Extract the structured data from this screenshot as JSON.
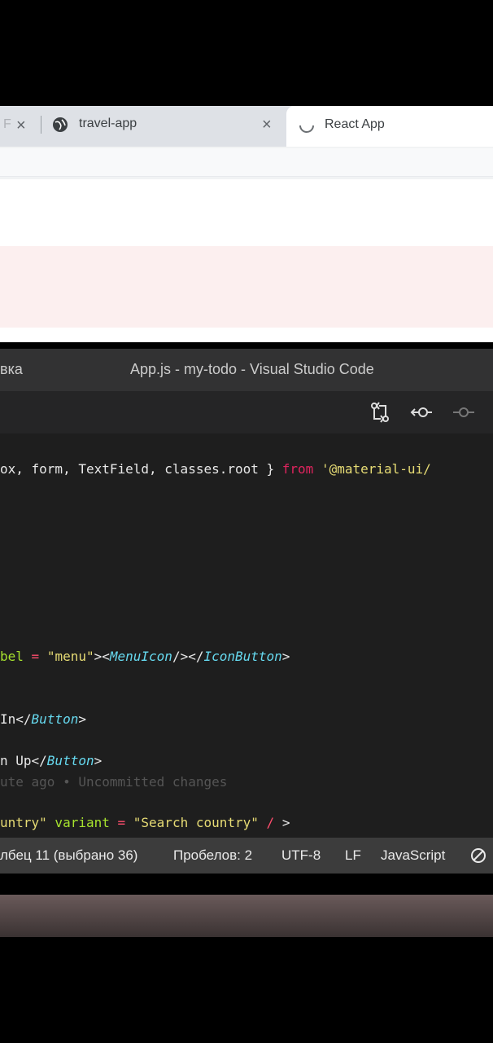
{
  "browser": {
    "tabs": [
      {
        "label": "F",
        "active": false
      },
      {
        "label": "travel-app",
        "active": false
      },
      {
        "label": "React App",
        "active": true
      }
    ]
  },
  "vscode": {
    "menu_partial": "вка",
    "title": "App.js - my-todo - Visual Studio Code",
    "code_lines": {
      "import_prefix": "ox, form, TextField, classes.root } ",
      "import_from": "from",
      "import_path": " '@material-ui/",
      "icon_line_a": "bel",
      "icon_line_b": " = ",
      "icon_line_c": "\"menu\"",
      "icon_line_d": "><",
      "icon_line_e": "MenuIcon",
      "icon_line_f": "/></",
      "icon_line_g": "IconButton",
      "icon_line_h": ">",
      "login_a": "In</",
      "login_b": "Button",
      "login_c": ">",
      "signup_a": "n Up</",
      "signup_b": "Button",
      "signup_c": ">",
      "blame": "ute ago • Uncommitted changes",
      "field_a": "untry\"",
      "field_b": " variant ",
      "field_c": "=",
      "field_d": " \"Search country\"",
      "field_e": " / ",
      "field_f": ">"
    },
    "status": {
      "column": "лбец 11 (выбрано 36)",
      "spaces": "Пробелов: 2",
      "encoding": "UTF-8",
      "eol": "LF",
      "language": "JavaScript"
    }
  }
}
